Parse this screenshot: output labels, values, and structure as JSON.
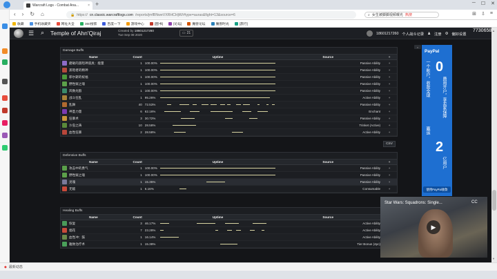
{
  "browser": {
    "tab_title": "Warcraft Logs - Combat Ana...",
    "tab_close": "×",
    "new_tab": "+",
    "url_host": "cn.classic.warcraftlogs.com",
    "url_path": "/reports/jmfBNweVXRHCHjW/#type=auras&fight=13&source=6",
    "url_scheme": "https://",
    "search_text": "女生被脚脚视频曝光",
    "search_hot": "热搜",
    "bookmarks": [
      {
        "label": "收藏",
        "color": "#f2b705"
      },
      {
        "label": "手机收藏夹",
        "color": "#4a90e2"
      },
      {
        "label": "网址大全",
        "color": "#e74c3c"
      },
      {
        "label": "360搜索",
        "color": "#27ae60"
      },
      {
        "label": "百度一下",
        "color": "#3b5bdb"
      },
      {
        "label": "游戏中心",
        "color": "#f39c12"
      },
      {
        "label": "[图书]",
        "color": "#c0392b"
      },
      {
        "label": "[论坛]",
        "color": "#8e44ad"
      },
      {
        "label": "魔兽论坛",
        "color": "#d35400"
      },
      {
        "label": "魔兽时光",
        "color": "#2980b9"
      },
      {
        "label": "[旅行]",
        "color": "#16a085"
      }
    ],
    "status_text": "最新动态"
  },
  "site": {
    "page_title": "Temple of Ahn'Qiraj",
    "created_by_label": "Created by",
    "created_by": "18601217260",
    "created_date": "Tue Sep 08 2020",
    "chat_count": "21",
    "user_name": "18601217260",
    "user_menu": "个人战斗记录",
    "register": "注册",
    "settings": "偏好设置",
    "counter": "7730658"
  },
  "damage": {
    "title": "Damage Buffs",
    "headers": {
      "name": "Name",
      "count": "Count",
      "uptime": "Uptime",
      "source": "Source"
    },
    "csv": "CSV",
    "rows": [
      {
        "name": "磨砺的黑暗神道具：能量",
        "count": "1",
        "pct": "100.00%",
        "source": "Passive Ability",
        "color": "#8d6cc8",
        "bars": [
          [
            0,
            100
          ]
        ]
      },
      {
        "name": "黑暗者的精神",
        "count": "1",
        "pct": "100.00%",
        "source": "Passive Ability",
        "color": "#b44a3c",
        "bars": [
          [
            0,
            100
          ]
        ]
      },
      {
        "name": "菲尔斯的祝福",
        "count": "1",
        "pct": "100.00%",
        "source": "Passive Ability",
        "color": "#4c9a3c",
        "bars": [
          [
            0,
            100
          ]
        ]
      },
      {
        "name": "野性赋之魂",
        "count": "1",
        "pct": "100.00%",
        "source": "Passive Ability",
        "color": "#5ca04a",
        "bars": [
          [
            0,
            100
          ]
        ]
      },
      {
        "name": "风数光狼",
        "count": "1",
        "pct": "100.00%",
        "source": "Passive Ability",
        "color": "#3a8a6a",
        "bars": [
          [
            0,
            100
          ]
        ]
      },
      {
        "name": "战斗狂乱",
        "count": "1",
        "pct": "95.26%",
        "source": "Active Ability",
        "color": "#a8823a",
        "bars": [
          [
            0,
            95
          ]
        ]
      },
      {
        "name": "乱舞",
        "count": "40",
        "pct": "72.53%",
        "source": "Passive Ability",
        "color": "#b06a30",
        "bars": [
          [
            6,
            10
          ],
          [
            17,
            25
          ],
          [
            28,
            32
          ],
          [
            36,
            42
          ],
          [
            44,
            49
          ],
          [
            52,
            56
          ],
          [
            58,
            61
          ],
          [
            66,
            70
          ],
          [
            72,
            78
          ],
          [
            84,
            86
          ],
          [
            92,
            94
          ],
          [
            97,
            99
          ]
        ]
      },
      {
        "name": "神圣力量",
        "count": "6",
        "pct": "62.16%",
        "source": "Enchant",
        "color": "#7a3ab0",
        "bars": [
          [
            4,
            18
          ],
          [
            26,
            34
          ],
          [
            44,
            63
          ],
          [
            71,
            79
          ],
          [
            84,
            93
          ]
        ]
      },
      {
        "name": "狂暴术",
        "count": "3",
        "pct": "30.72%",
        "source": "Passive Ability",
        "color": "#c8963a",
        "bars": [
          [
            18,
            30
          ],
          [
            56,
            63
          ],
          [
            77,
            84
          ]
        ]
      },
      {
        "name": "沙虫之祷",
        "count": "10",
        "pct": "28.58%",
        "source": "Trinket (Active)",
        "color": "#5a8a3a",
        "bars": [
          [
            11,
            31
          ]
        ]
      },
      {
        "name": "血性狂暴",
        "count": "2",
        "pct": "28.58%",
        "source": "Active Ability",
        "color": "#b8463a",
        "bars": [
          [
            12,
            22
          ],
          [
            62,
            72
          ]
        ]
      }
    ]
  },
  "defensive": {
    "title": "Defensive Buffs",
    "headers": {
      "name": "Name",
      "count": "Count",
      "uptime": "Uptime",
      "source": "Source"
    },
    "rows": [
      {
        "name": "攻击中的勇气",
        "count": "1",
        "pct": "100.00%",
        "source": "Passive Ability",
        "color": "#5aa04a",
        "bars": [
          [
            0,
            100
          ]
        ]
      },
      {
        "name": "野性赋之魂",
        "count": "1",
        "pct": "100.00%",
        "source": "Passive Ability",
        "color": "#5ca04a",
        "bars": [
          [
            0,
            100
          ]
        ]
      },
      {
        "name": "灵魂",
        "count": "1",
        "pct": "15.35%",
        "source": "Passive Ability",
        "color": "#7a7a9a",
        "bars": [
          [
            40,
            56
          ]
        ]
      },
      {
        "name": "无敌",
        "count": "1",
        "pct": "6.16%",
        "source": "Consumable",
        "color": "#c84a3a",
        "bars": [
          [
            17,
            23
          ]
        ]
      }
    ]
  },
  "healing": {
    "title": "Healing Buffs",
    "headers": {
      "name": "Name",
      "count": "Count",
      "uptime": "Uptime",
      "source": "Source"
    },
    "rows": [
      {
        "name": "恢复",
        "count": "3",
        "pct": "46.17%",
        "source": "Active Ability",
        "color": "#4a9a5a",
        "bars": [
          [
            0,
            8
          ],
          [
            32,
            48
          ],
          [
            56,
            68
          ],
          [
            80,
            92
          ]
        ]
      },
      {
        "name": "烟花",
        "count": "7",
        "pct": "23.28%",
        "source": "Active Ability",
        "color": "#c84a3a",
        "bars": [
          [
            0,
            3
          ],
          [
            48,
            50
          ],
          [
            58,
            62
          ],
          [
            66,
            70
          ],
          [
            78,
            82
          ],
          [
            88,
            90
          ]
        ]
      },
      {
        "name": "血性冲：鼓",
        "count": "1",
        "pct": "16.14%",
        "source": "Active Ability",
        "color": "#6a8a4a",
        "bars": [
          [
            0,
            16
          ]
        ]
      },
      {
        "name": "雅致治疗术",
        "count": "1",
        "pct": "15.38%",
        "source": "Tier Bonus (4pc)",
        "color": "#4aa05a",
        "bars": [
          [
            52,
            67
          ]
        ]
      }
    ]
  },
  "ad": {
    "brand": "PayPal",
    "line1": "一个账户，收款全球",
    "zero": "0",
    "line2": "费用开户，享卖家保障",
    "line3": "赢追",
    "two": "2",
    "line4": "亿用户",
    "cta": "使用PayPal收款",
    "close": "×"
  },
  "video": {
    "title": "Star Wars: Squadrons: Single...",
    "cc": "CC",
    "play": "▶"
  }
}
